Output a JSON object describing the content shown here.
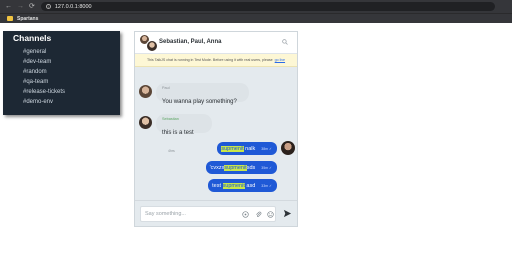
{
  "browser": {
    "back_glyph": "←",
    "forward_glyph": "→",
    "reload_glyph": "⟳",
    "url": "127.0.0.1:8000",
    "info_glyph": "i",
    "bookmark_label": "Spartans"
  },
  "channels": {
    "title": "Channels",
    "items": [
      "#general",
      "#dev-team",
      "#random",
      "#qa-team",
      "#release-tickets",
      "#demo-env"
    ]
  },
  "chat": {
    "title": "Sebastian, Paul, Anna",
    "notice_text": "This TalkJS chat is running in Test Mode. Before using it with real users, please",
    "notice_link": "go live",
    "messages_in": [
      {
        "sender": "Paul",
        "text": "You wanna play something?",
        "time": "4hrs"
      },
      {
        "sender": "Sebastian",
        "text": "this is a test",
        "time": "4hrs"
      }
    ],
    "messages_out": [
      {
        "pre": "",
        "highlight": "supmenit",
        "post": " nalk",
        "time": "38m ✓"
      },
      {
        "pre": "'cvxzx",
        "highlight": "supmenit",
        "post": "sds",
        "time": "35m ✓"
      },
      {
        "pre": "test ",
        "highlight": "supmenit",
        "post": " asd",
        "time": "33m ✓"
      }
    ],
    "composer_placeholder": "Say something..."
  },
  "colors": {
    "channels_bg": "#1d2834",
    "outgoing_bubble": "#1f59d6",
    "highlight": "#c8e64a",
    "notice_bg": "#fdf7d5"
  }
}
